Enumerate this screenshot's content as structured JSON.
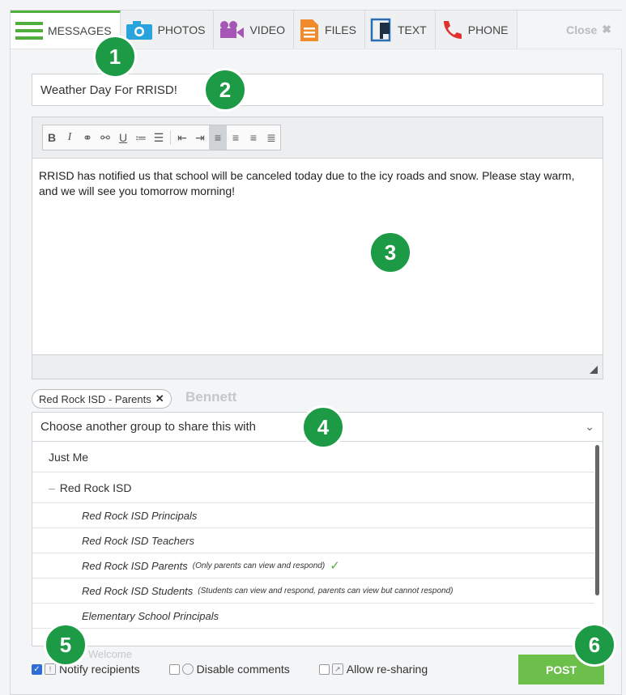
{
  "tabs": [
    {
      "label": "MESSAGES",
      "icon": "messages-lines-icon",
      "color": "#4fae3c"
    },
    {
      "label": "PHOTOS",
      "icon": "camera-icon",
      "color": "#29a3db"
    },
    {
      "label": "VIDEO",
      "icon": "video-camera-icon",
      "color": "#a556b6"
    },
    {
      "label": "FILES",
      "icon": "file-icon",
      "color": "#f08a2b"
    },
    {
      "label": "TEXT",
      "icon": "text-document-icon",
      "color": "#2a6db0"
    },
    {
      "label": "PHONE",
      "icon": "phone-icon",
      "color": "#e03131"
    }
  ],
  "close_label": "Close",
  "subject_value": "Weather Day For RRISD!",
  "body_text": "RRISD has notified us that school will be canceled today due to the icy roads and snow. Please stay warm, and we will see you tomorrow morning!",
  "chip_label": "Red Rock ISD - Parents",
  "dropdown_placeholder": "Choose another group to share this with",
  "options": [
    {
      "label": "Just Me"
    },
    {
      "label": "Red Rock ISD"
    },
    {
      "label": "Red Rock ISD Principals"
    },
    {
      "label": "Red Rock ISD Teachers"
    },
    {
      "label": "Red Rock ISD Parents",
      "note": "(Only parents can view and respond)"
    },
    {
      "label": "Red Rock ISD Students",
      "note": "(Students can view and respond, parents can view but cannot respond)"
    },
    {
      "label": "Elementary School Principals"
    }
  ],
  "notify_label": "Notify recipients",
  "disable_comments_label": "Disable comments",
  "allow_resharing_label": "Allow re-sharing",
  "post_label": "POST",
  "callouts": [
    "1",
    "2",
    "3",
    "4",
    "5",
    "6"
  ],
  "ghost_texts": [
    "MESSAGES",
    "PHOTOS",
    "VIDEO",
    "FILES",
    "TEXT",
    "PHONE",
    "Bennett",
    "Welcome"
  ],
  "accent_green": "#1c9a45"
}
